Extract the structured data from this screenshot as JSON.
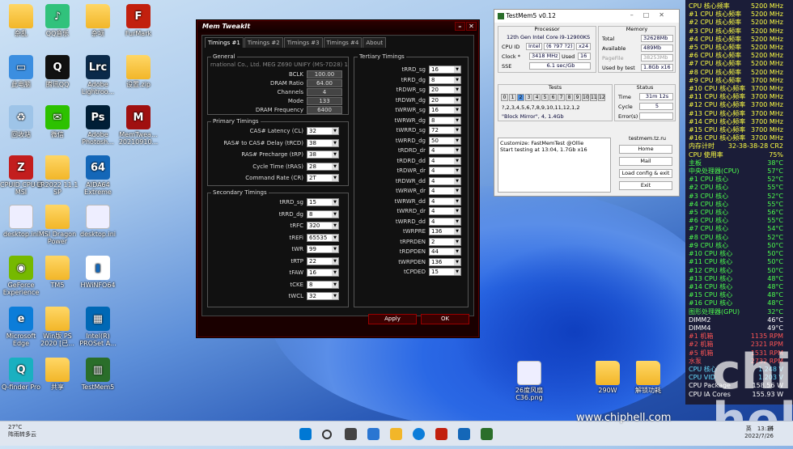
{
  "desktop_icons": [
    {
      "label": "杂乱",
      "kind": "folder"
    },
    {
      "label": "QQ音乐",
      "kind": "app",
      "color": "#31c27c",
      "glyph": "♪"
    },
    {
      "label": "杂项",
      "kind": "folder"
    },
    {
      "label": "FurMark",
      "kind": "app",
      "color": "#c2200e",
      "glyph": "F"
    },
    {
      "label": "此电脑",
      "kind": "app",
      "color": "#3b8ee0",
      "glyph": "▭"
    },
    {
      "label": "腾讯QQ",
      "kind": "app",
      "color": "#111",
      "glyph": "Q"
    },
    {
      "label": "Adobe Lightroo...",
      "kind": "app",
      "color": "#0b2a4a",
      "glyph": "Lrc"
    },
    {
      "label": "设置.zip",
      "kind": "folder"
    },
    {
      "label": "回收站",
      "kind": "app",
      "color": "#9ec4e8",
      "glyph": "♻"
    },
    {
      "label": "微信",
      "kind": "app",
      "color": "#2dc100",
      "glyph": "✉"
    },
    {
      "label": "Adobe Photosh...",
      "kind": "app",
      "color": "#001e36",
      "glyph": "Ps"
    },
    {
      "label": "MemTwea... 20210910...",
      "kind": "app",
      "color": "#a01010",
      "glyph": "M"
    },
    {
      "label": "CPUID CPU-Z MSI",
      "kind": "app",
      "color": "#c31e1e",
      "glyph": "Z"
    },
    {
      "label": "LR2022 11.1 SP",
      "kind": "folder"
    },
    {
      "label": "AIDA64 Extreme",
      "kind": "app",
      "color": "#1467b8",
      "glyph": "64"
    },
    {
      "label": "desktop.ini",
      "kind": "file"
    },
    {
      "label": "MSI Dragon Power",
      "kind": "folder"
    },
    {
      "label": "desktop.ini",
      "kind": "file"
    },
    {
      "label": "GeForce Experience",
      "kind": "app",
      "color": "#76b900",
      "glyph": "◉"
    },
    {
      "label": "TM5",
      "kind": "folder"
    },
    {
      "label": "HWiNFO64",
      "kind": "app",
      "color": "#fff",
      "glyph": "▮"
    },
    {
      "label": "Microsoft Edge",
      "kind": "app",
      "color": "#0c7dd9",
      "glyph": "e"
    },
    {
      "label": "Win版 PS 2020 [已...",
      "kind": "folder"
    },
    {
      "label": "Intel(R) PROSet A...",
      "kind": "app",
      "color": "#0068b5",
      "glyph": "▦"
    },
    {
      "label": "Q-finder Pro",
      "kind": "app",
      "color": "#1ab0c0",
      "glyph": "Q"
    },
    {
      "label": "共享",
      "kind": "folder"
    },
    {
      "label": "TestMem5",
      "kind": "app",
      "color": "#2a6e2a",
      "glyph": "▥"
    },
    {
      "label": "26度风扇 C36.png",
      "kind": "file"
    },
    {
      "label": "290W",
      "kind": "folder"
    },
    {
      "label": "解锁功耗",
      "kind": "folder"
    }
  ],
  "sidebar": [
    {
      "label": "CPU 核心频率",
      "value": "5200 MHz",
      "color": "yellow"
    },
    {
      "label": "#1 CPU 核心频率",
      "value": "5200 MHz",
      "color": "yellow"
    },
    {
      "label": "#2 CPU 核心频率",
      "value": "5200 MHz",
      "color": "yellow"
    },
    {
      "label": "#3 CPU 核心频率",
      "value": "5200 MHz",
      "color": "yellow"
    },
    {
      "label": "#4 CPU 核心频率",
      "value": "5200 MHz",
      "color": "yellow"
    },
    {
      "label": "#5 CPU 核心频率",
      "value": "5200 MHz",
      "color": "yellow"
    },
    {
      "label": "#6 CPU 核心频率",
      "value": "5200 MHz",
      "color": "yellow"
    },
    {
      "label": "#7 CPU 核心频率",
      "value": "5200 MHz",
      "color": "yellow"
    },
    {
      "label": "#8 CPU 核心频率",
      "value": "5200 MHz",
      "color": "yellow"
    },
    {
      "label": "#9 CPU 核心频率",
      "value": "3700 MHz",
      "color": "yellow"
    },
    {
      "label": "#10 CPU 核心频率",
      "value": "3700 MHz",
      "color": "yellow"
    },
    {
      "label": "#11 CPU 核心频率",
      "value": "3700 MHz",
      "color": "yellow"
    },
    {
      "label": "#12 CPU 核心频率",
      "value": "3700 MHz",
      "color": "yellow"
    },
    {
      "label": "#13 CPU 核心频率",
      "value": "3700 MHz",
      "color": "yellow"
    },
    {
      "label": "#14 CPU 核心频率",
      "value": "3700 MHz",
      "color": "yellow"
    },
    {
      "label": "#15 CPU 核心频率",
      "value": "3700 MHz",
      "color": "yellow"
    },
    {
      "label": "#16 CPU 核心频率",
      "value": "3700 MHz",
      "color": "yellow"
    },
    {
      "label": "内存计时",
      "value": "32-38-38-28 CR2",
      "color": "yellow"
    },
    {
      "label": "CPU 使用率",
      "value": "75%",
      "color": "yellow"
    },
    {
      "label": "主板",
      "value": "38°C",
      "color": "green"
    },
    {
      "label": "中央处理器(CPU)",
      "value": "57°C",
      "color": "green"
    },
    {
      "label": "#1 CPU 核心",
      "value": "52°C",
      "color": "green"
    },
    {
      "label": "#2 CPU 核心",
      "value": "55°C",
      "color": "green"
    },
    {
      "label": "#3 CPU 核心",
      "value": "52°C",
      "color": "green"
    },
    {
      "label": "#4 CPU 核心",
      "value": "55°C",
      "color": "green"
    },
    {
      "label": "#5 CPU 核心",
      "value": "56°C",
      "color": "green"
    },
    {
      "label": "#6 CPU 核心",
      "value": "55°C",
      "color": "green"
    },
    {
      "label": "#7 CPU 核心",
      "value": "54°C",
      "color": "green"
    },
    {
      "label": "#8 CPU 核心",
      "value": "52°C",
      "color": "green"
    },
    {
      "label": "#9 CPU 核心",
      "value": "50°C",
      "color": "green"
    },
    {
      "label": "#10 CPU 核心",
      "value": "50°C",
      "color": "green"
    },
    {
      "label": "#11 CPU 核心",
      "value": "50°C",
      "color": "green"
    },
    {
      "label": "#12 CPU 核心",
      "value": "50°C",
      "color": "green"
    },
    {
      "label": "#13 CPU 核心",
      "value": "48°C",
      "color": "green"
    },
    {
      "label": "#14 CPU 核心",
      "value": "48°C",
      "color": "green"
    },
    {
      "label": "#15 CPU 核心",
      "value": "48°C",
      "color": "green"
    },
    {
      "label": "#16 CPU 核心",
      "value": "48°C",
      "color": "green"
    },
    {
      "label": "图形处理器(GPU)",
      "value": "32°C",
      "color": "green"
    },
    {
      "label": "DIMM2",
      "value": "46°C",
      "color": "white"
    },
    {
      "label": "DIMM4",
      "value": "49°C",
      "color": "white"
    },
    {
      "label": "#1 机箱",
      "value": "1135 RPM",
      "color": "red"
    },
    {
      "label": "#2 机箱",
      "value": "2321 RPM",
      "color": "red"
    },
    {
      "label": "#5 机箱",
      "value": "1531 RPM",
      "color": "red"
    },
    {
      "label": "水泵",
      "value": "2732 RPM",
      "color": "red"
    },
    {
      "label": "CPU 核心",
      "value": "1.248 V",
      "color": "cyan"
    },
    {
      "label": "CPU VID",
      "value": "1.203 V",
      "color": "cyan"
    },
    {
      "label": "CPU Package",
      "value": "158.56 W",
      "color": "white"
    },
    {
      "label": "CPU IA Cores",
      "value": "155.93 W",
      "color": "white"
    }
  ],
  "memtweak": {
    "title": "Mem TweakIt",
    "tabs": [
      "Timings #1",
      "Timings #2",
      "Timings #3",
      "Timings #4",
      "About"
    ],
    "general": {
      "title": "General",
      "board": "rnational Co., Ltd. MEG Z690 UNIFY (MS-7D28) 1.70",
      "rows": [
        {
          "label": "BCLK",
          "value": "100.00"
        },
        {
          "label": "DRAM Ratio",
          "value": "64.00"
        },
        {
          "label": "Channels",
          "value": "4"
        },
        {
          "label": "Mode",
          "value": "133"
        },
        {
          "label": "DRAM Frequency",
          "value": "6400"
        }
      ]
    },
    "primary": {
      "title": "Primary Timings",
      "rows": [
        {
          "label": "CAS# Latency (CL)",
          "value": "32"
        },
        {
          "label": "RAS# to CAS# Delay (tRCD)",
          "value": "38"
        },
        {
          "label": "RAS# Precharge (tRP)",
          "value": "38"
        },
        {
          "label": "Cycle Time (tRAS)",
          "value": "28"
        },
        {
          "label": "Command Rate (CR)",
          "value": "2T"
        }
      ]
    },
    "secondary": {
      "title": "Secondary Timings",
      "rows": [
        {
          "label": "tRRD_sg",
          "value": "15"
        },
        {
          "label": "tRRD_dg",
          "value": "8"
        },
        {
          "label": "tRFC",
          "value": "320"
        },
        {
          "label": "tREFi",
          "value": "65535"
        },
        {
          "label": "tWR",
          "value": "99"
        },
        {
          "label": "tRTP",
          "value": "22"
        },
        {
          "label": "tFAW",
          "value": "16"
        },
        {
          "label": "tCKE",
          "value": "8"
        },
        {
          "label": "tWCL",
          "value": "32"
        }
      ]
    },
    "tertiary": {
      "title": "Tertiary Timings",
      "rows": [
        {
          "label": "tRRD_sg",
          "value": "16"
        },
        {
          "label": "tRRD_dg",
          "value": "8"
        },
        {
          "label": "tRDWR_sg",
          "value": "20"
        },
        {
          "label": "tRDWR_dg",
          "value": "20"
        },
        {
          "label": "tWRWR_sg",
          "value": "16"
        },
        {
          "label": "tWRWR_dg",
          "value": "8"
        },
        {
          "label": "tWRRD_sg",
          "value": "72"
        },
        {
          "label": "tWRRD_dg",
          "value": "50"
        },
        {
          "label": "tRDRD_dr",
          "value": "4"
        },
        {
          "label": "tRDRD_dd",
          "value": "4"
        },
        {
          "label": "tRDWR_dr",
          "value": "4"
        },
        {
          "label": "tRDWR_dd",
          "value": "4"
        },
        {
          "label": "tWRWR_dr",
          "value": "4"
        },
        {
          "label": "tWRWR_dd",
          "value": "4"
        },
        {
          "label": "tWRRD_dr",
          "value": "4"
        },
        {
          "label": "tWRRD_dd",
          "value": "4"
        },
        {
          "label": "tWRPRE",
          "value": "136"
        },
        {
          "label": "tRPRDEN",
          "value": "2"
        },
        {
          "label": "tRDPDEN",
          "value": "44"
        },
        {
          "label": "tWRPDEN",
          "value": "136"
        },
        {
          "label": "tCPDED",
          "value": "15"
        }
      ]
    },
    "apply": "Apply",
    "ok": "OK"
  },
  "testmem": {
    "title": "TestMem5 v0.12",
    "processor_title": "Processor",
    "cpu": "12th Gen Intel Core i9-12900KS",
    "cpuid_label": "CPU ID",
    "cpuid_vendor": "Intel",
    "cpuid_code": "(6 ?97 ?2)",
    "cpuid_threads": "x24",
    "clock_label": "Clock *",
    "clock": "3418 MHz",
    "used_label": "Used",
    "used": "16",
    "sse_label": "SSE",
    "sse": "6.1 sec/Gb",
    "memory_title": "Memory",
    "total_label": "Total",
    "total": "32628Mb",
    "avail_label": "Available",
    "avail": "489Mb",
    "pagefile_label": "PageFile",
    "pagefile": "38253Mb",
    "usedby_label": "Used by test",
    "usedby": "1.8Gb x16",
    "tests_title": "Tests",
    "threads": [
      "0",
      "1",
      "2",
      "3",
      "4",
      "5",
      "6",
      "7",
      "8",
      "9",
      "10",
      "11",
      "12"
    ],
    "test_seq": "?,2,3,4,5,6,7,8,9,10,11,12,1,2",
    "test_name": "\"Block Mirror\", 4, 1.4Gb",
    "status_title": "Status",
    "time_label": "Time",
    "time": "31m 12s",
    "cycle_label": "Cycle",
    "cycle": "5",
    "errors_label": "Error(s)",
    "errors": "",
    "log": [
      "Customize: FastMemTest @Ollie",
      "Start testing at 13:04, 1.7Gb x16"
    ],
    "site": "testmem.tz.ru",
    "home": "Home",
    "mail": "Mail",
    "loadcfg": "Load config & exit",
    "exit": "Exit"
  },
  "taskbar": {
    "temp": "27°C",
    "weather": "阵雨转多云",
    "ime1": "英",
    "ime2": "拼",
    "time": "13:36",
    "date": "2022/7/26"
  },
  "watermark": "www.chiphell.com",
  "chi_logo": "chi hell"
}
